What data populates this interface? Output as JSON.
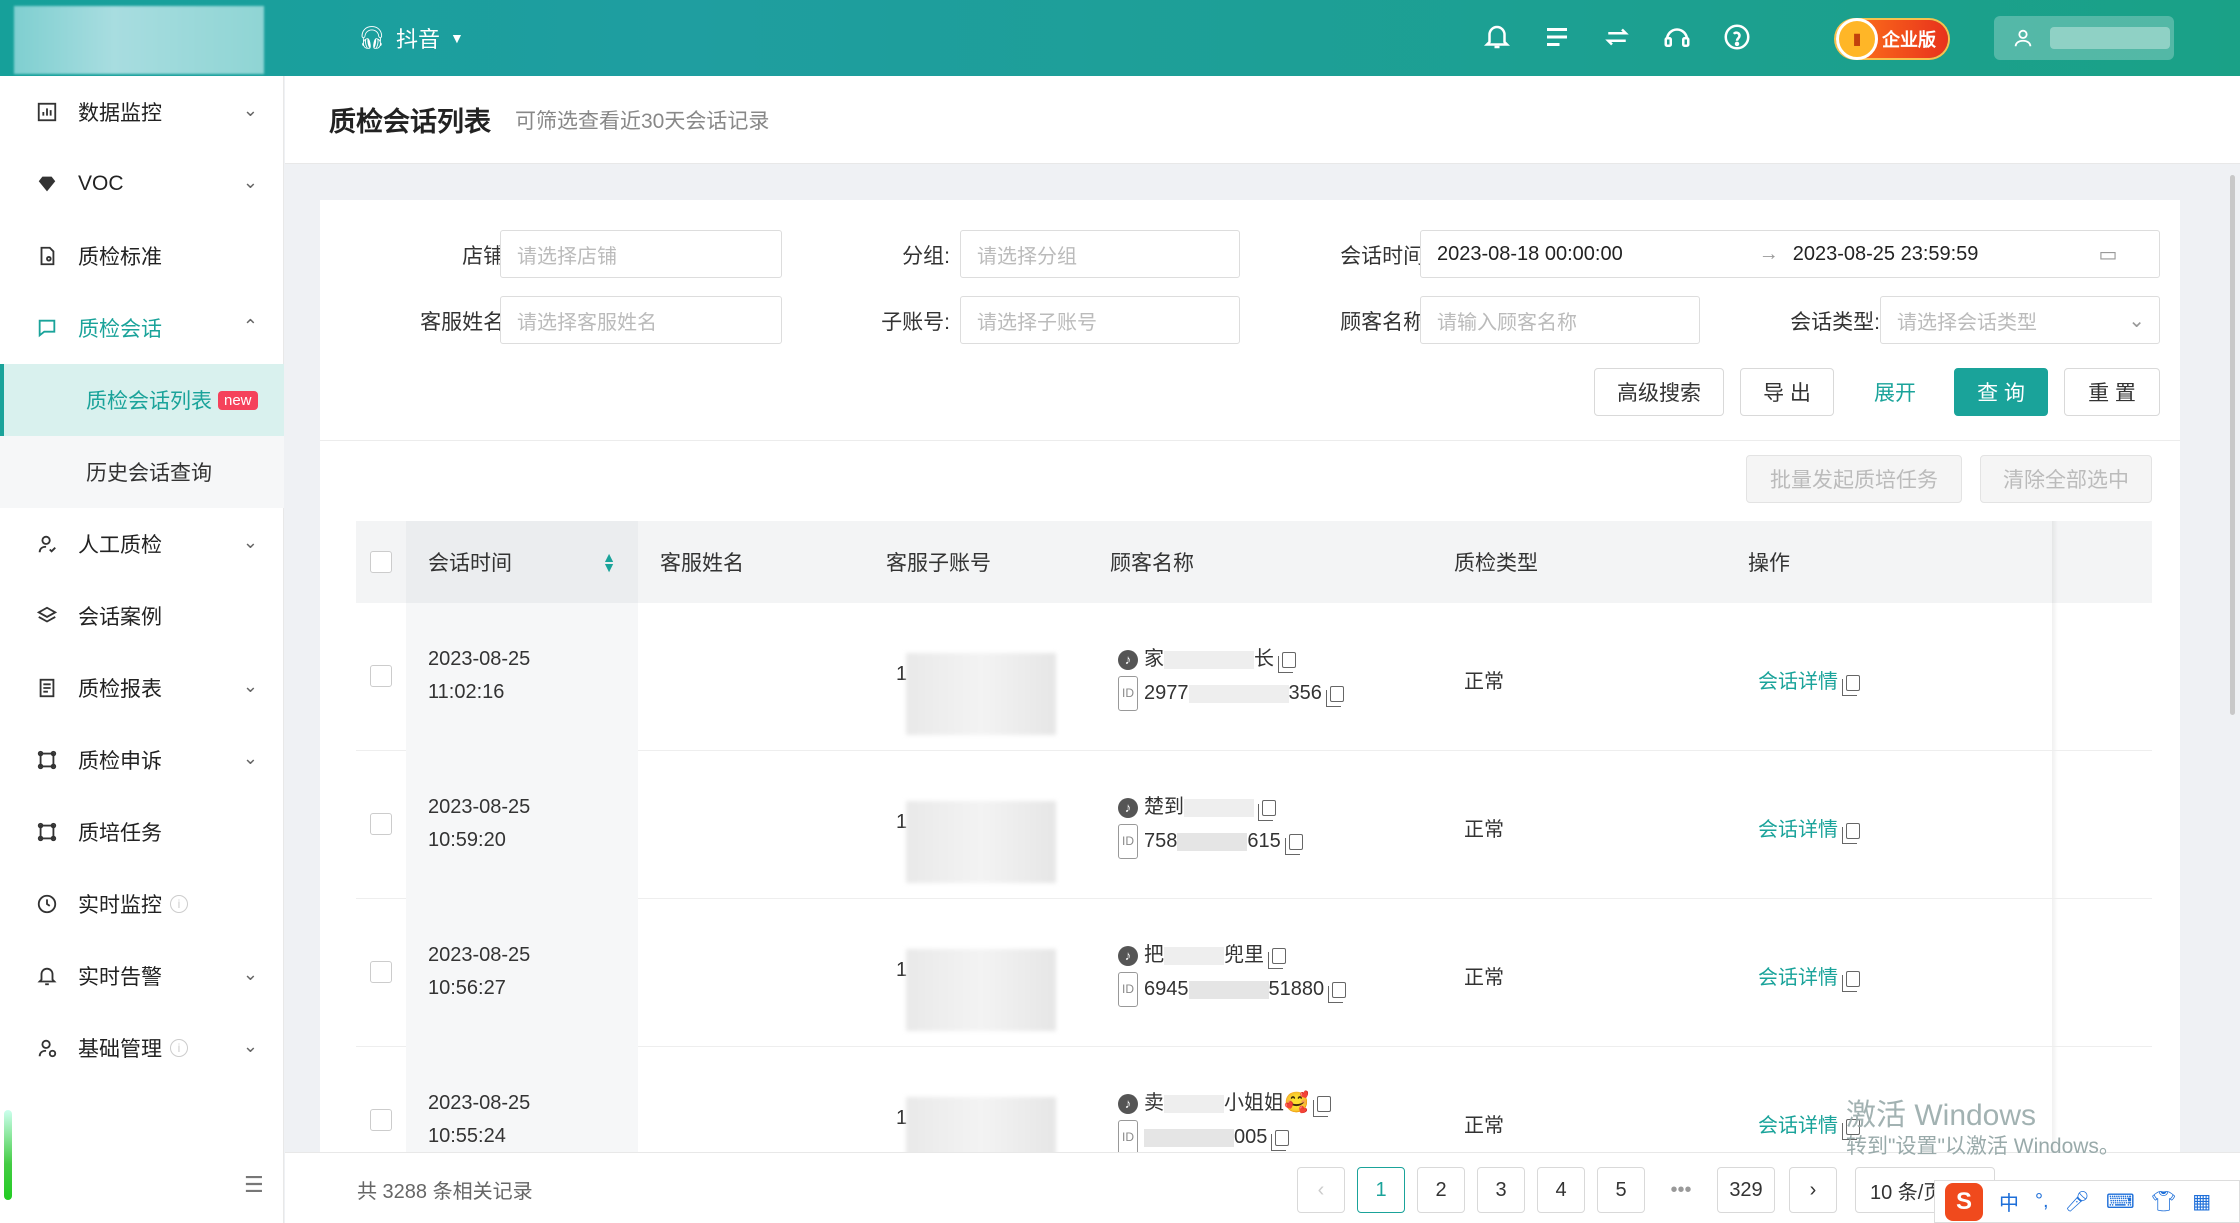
{
  "header": {
    "platform": "抖音",
    "enterprise": "企业版",
    "icons": [
      "bell-icon",
      "list-icon",
      "exchange-icon",
      "headset-icon",
      "help-icon"
    ]
  },
  "sidebar": {
    "items": [
      {
        "label": "数据监控",
        "icon": "chart-icon",
        "chevron": "⌄"
      },
      {
        "label": "VOC",
        "icon": "diamond-icon",
        "chevron": "⌄"
      },
      {
        "label": "质检标准",
        "icon": "doc-icon",
        "chevron": ""
      },
      {
        "label": "质检会话",
        "icon": "chat-icon",
        "chevron": "⌃"
      },
      {
        "label": "人工质检",
        "icon": "person-icon",
        "chevron": "⌄"
      },
      {
        "label": "会话案例",
        "icon": "layers-icon",
        "chevron": ""
      },
      {
        "label": "质检报表",
        "icon": "report-icon",
        "chevron": "⌄"
      },
      {
        "label": "质检申诉",
        "icon": "appeal-icon",
        "chevron": "⌄"
      },
      {
        "label": "质培任务",
        "icon": "task-icon",
        "chevron": ""
      },
      {
        "label": "实时监控",
        "icon": "clock-icon",
        "chevron": ""
      },
      {
        "label": "实时告警",
        "icon": "alarm-icon",
        "chevron": "⌄"
      },
      {
        "label": "基础管理",
        "icon": "admin-icon",
        "chevron": "⌄"
      }
    ],
    "sub": [
      {
        "label": "质检会话列表",
        "badge": "new"
      },
      {
        "label": "历史会话查询"
      }
    ]
  },
  "page": {
    "title": "质检会话列表",
    "subtitle": "可筛选查看近30天会话记录"
  },
  "filters": {
    "shop": {
      "label": "店铺:",
      "placeholder": "请选择店铺"
    },
    "group": {
      "label": "分组:",
      "placeholder": "请选择分组"
    },
    "time": {
      "label": "会话时间:",
      "start": "2023-08-18 00:00:00",
      "end": "2023-08-25 23:59:59"
    },
    "agent": {
      "label": "客服姓名:",
      "placeholder": "请选择客服姓名"
    },
    "subacct": {
      "label": "子账号:",
      "placeholder": "请选择子账号"
    },
    "customer": {
      "label": "顾客名称:",
      "placeholder": "请输入顾客名称"
    },
    "type": {
      "label": "会话类型:",
      "placeholder": "请选择会话类型"
    }
  },
  "buttons": {
    "advanced": "高级搜索",
    "export": "导 出",
    "expand": "展开",
    "query": "查 询",
    "reset": "重 置",
    "batch": "批量发起质培任务",
    "clear": "清除全部选中"
  },
  "table": {
    "headers": [
      "会话时间",
      "客服姓名",
      "客服子账号",
      "顾客名称",
      "质检类型",
      "操作"
    ],
    "rows": [
      {
        "date": "2023-08-25",
        "time": "11:02:16",
        "acct": "1",
        "cust": "家",
        "cust2": "长",
        "id1": "2977",
        "id2": "356",
        "qtype": "正常",
        "action": "会话详情"
      },
      {
        "date": "2023-08-25",
        "time": "10:59:20",
        "acct": "1",
        "cust": "楚到",
        "cust2": "",
        "id1": "758",
        "id2": "615",
        "qtype": "正常",
        "action": "会话详情"
      },
      {
        "date": "2023-08-25",
        "time": "10:56:27",
        "acct": "1",
        "cust": "把",
        "cust2": "兜里",
        "id1": "6945",
        "id2": "51880",
        "qtype": "正常",
        "action": "会话详情"
      },
      {
        "date": "2023-08-25",
        "time": "10:55:24",
        "acct": "1",
        "cust": "卖",
        "cust2": "小姐姐🥰",
        "id1": "",
        "id2": "005",
        "qtype": "正常",
        "action": "会话详情"
      }
    ]
  },
  "pagination": {
    "total": "共 3288 条相关记录",
    "pages": [
      "1",
      "2",
      "3",
      "4",
      "5",
      "•••",
      "329"
    ],
    "size": "10 条/页"
  },
  "watermark": {
    "line1": "激活 Windows",
    "line2": "转到\"设置\"以激活 Windows。"
  },
  "ime": {
    "logo": "S",
    "lang": "中"
  }
}
